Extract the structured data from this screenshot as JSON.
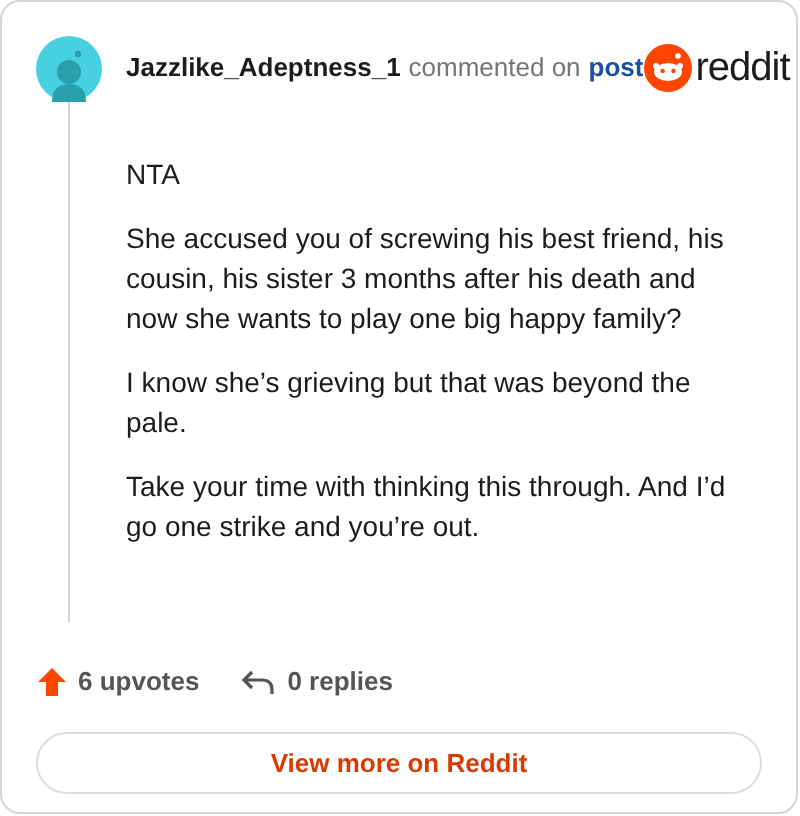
{
  "header": {
    "username": "Jazzlike_Adeptness_1",
    "action": "commented on",
    "link": "post",
    "brand": "reddit"
  },
  "paragraphs": [
    "NTA",
    "She accused you of screwing his best friend, his cousin, his sister 3 months after his death and now she wants to play one big happy family?",
    "I know she’s grieving but that was beyond the pale.",
    "Take your time with thinking this through. And I’d go one strike and you’re out."
  ],
  "stats": {
    "upvotes": "6 upvotes",
    "replies": "0 replies"
  },
  "button": "View more on Reddit"
}
